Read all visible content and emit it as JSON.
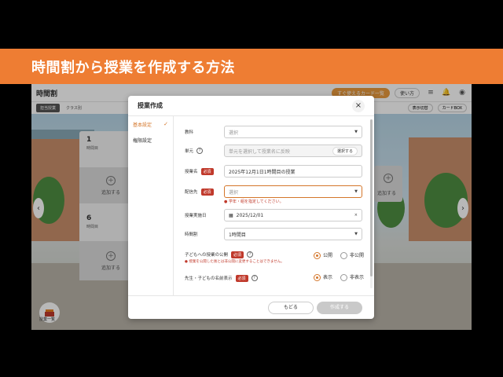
{
  "banner": {
    "title": "時間割から授業を作成する方法"
  },
  "app": {
    "title": "時間割",
    "topbar": {
      "quick_card": "すぐ使えるカード一覧",
      "help": "使い方"
    },
    "tabs": [
      "担当授業",
      "クラス別"
    ],
    "subbar_right": [
      "表示切替",
      "カードBOX"
    ],
    "cards": [
      {
        "num": "1",
        "unit": "時間目",
        "add": "追加する"
      },
      {
        "num": "6",
        "unit": "時間目",
        "add": "追加する"
      }
    ],
    "right_add_label": "追加する",
    "bottom_label": "授業一覧"
  },
  "modal": {
    "title": "授業作成",
    "sidebar": [
      "基本設定",
      "権限設定"
    ],
    "fields": {
      "subject": {
        "label": "教科",
        "placeholder": "選択"
      },
      "unit": {
        "label": "単元",
        "placeholder": "単元を選択して授業名に反映",
        "button": "選択する"
      },
      "name": {
        "label": "授業名",
        "required": "必須",
        "value": "2025年12月1日1時間目の授業"
      },
      "target": {
        "label": "配信先",
        "required": "必須",
        "placeholder": "選択",
        "error": "学年・組を指定してください。"
      },
      "date": {
        "label": "授業実施日",
        "value": "2025/12/01"
      },
      "period": {
        "label": "時間割",
        "value": "1時間目"
      },
      "publish": {
        "label": "子どもへの授業の公開",
        "required": "必須",
        "note": "授業を公開した後とは非公開に変更することはできません。",
        "options": [
          "公開",
          "非公開"
        ],
        "selected": "公開"
      },
      "show_name": {
        "label": "先生・子どもの名前表示",
        "required": "必須",
        "options": [
          "表示",
          "非表示"
        ],
        "selected": "表示"
      }
    },
    "footer": {
      "back": "もどる",
      "create": "作成する"
    }
  }
}
